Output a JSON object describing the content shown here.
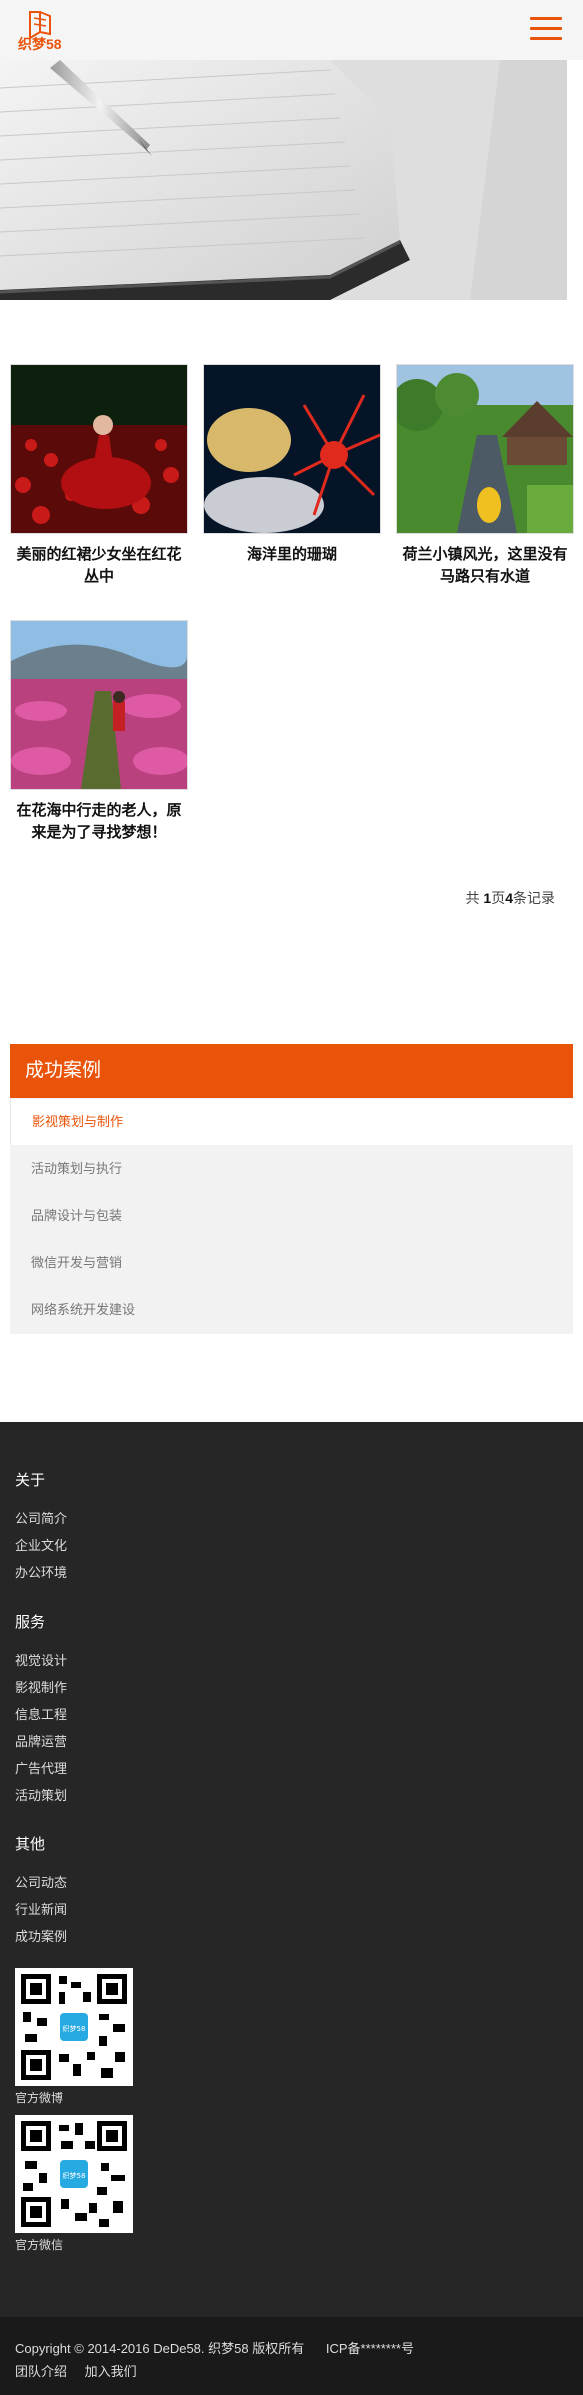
{
  "header": {
    "logo_text": "织梦58",
    "brand_color": "#e9540a",
    "menu_icon": "hamburger-menu-icon"
  },
  "gallery": {
    "items": [
      {
        "title": "美丽的红裙少女坐在红花丛中"
      },
      {
        "title": "海洋里的珊瑚"
      },
      {
        "title": "荷兰小镇风光，这里没有马路只有水道"
      },
      {
        "title": "在花海中行走的老人，原来是为了寻找梦想！"
      }
    ],
    "records": {
      "prefix": "共",
      "pages": "1",
      "mid": "页",
      "count": "4",
      "suffix": "条记录"
    }
  },
  "sidebar": {
    "title": "成功案例",
    "items": [
      {
        "label": "影视策划与制作",
        "active": true
      },
      {
        "label": "活动策划与执行"
      },
      {
        "label": "品牌设计与包装"
      },
      {
        "label": "微信开发与营销"
      },
      {
        "label": "网络系统开发建设"
      }
    ]
  },
  "footer": {
    "sections": [
      {
        "title": "关于",
        "links": [
          "公司简介",
          "企业文化",
          "办公环境"
        ]
      },
      {
        "title": "服务",
        "links": [
          "视觉设计",
          "影视制作",
          "信息工程",
          "品牌运营",
          "广告代理",
          "活动策划"
        ]
      },
      {
        "title": "其他",
        "links": [
          "公司动态",
          "行业新闻",
          "成功案例"
        ]
      }
    ],
    "qr_codes": [
      {
        "label": "官方微博",
        "logo": "织梦58"
      },
      {
        "label": "官方微信",
        "logo": "织梦58"
      }
    ],
    "copyright": "Copyright © 2014-2016 DeDe58. 织梦58 版权所有",
    "icp": "ICP备********号",
    "bottom_links": [
      "团队介绍",
      "加入我们"
    ]
  }
}
